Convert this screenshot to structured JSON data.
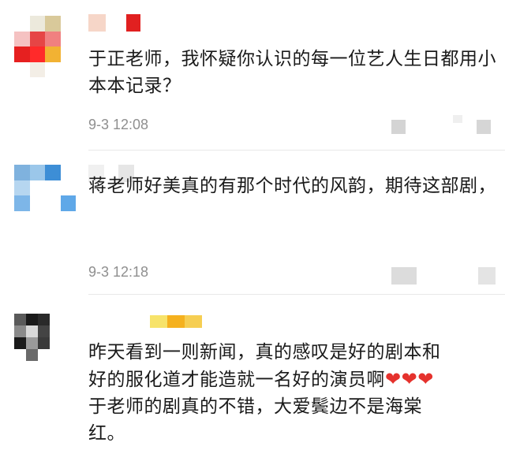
{
  "comments": [
    {
      "text": "于正老师，我怀疑你认识的每一位艺人生日都用小本本记录？",
      "time": "9-3 12:08"
    },
    {
      "text": "蒋老师好美真的有那个时代的风韵，期待这部剧，",
      "time": "9-3 12:18"
    },
    {
      "text_line1": "昨天看到一则新闻，真的感叹是好的剧本和",
      "text_line2": "好的服化道才能造就一名好的演员啊",
      "hearts": "❤❤❤",
      "text_line3": "于老师的剧真的不错，大爱鬓边不是海棠",
      "text_line4": "红。"
    }
  ],
  "icons": {
    "heart": "heart-icon"
  },
  "colors": {
    "text": "#1a1a1a",
    "meta": "#8f8f8f",
    "heart": "#e5322d",
    "divider": "#e8e8e8"
  }
}
